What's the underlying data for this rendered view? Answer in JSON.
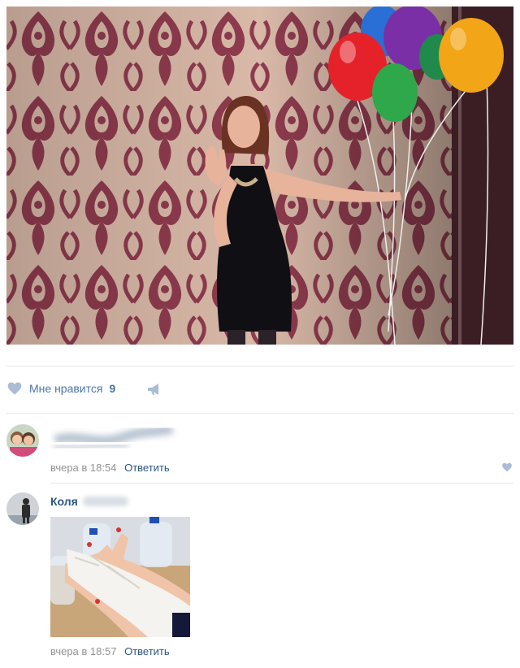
{
  "post": {
    "likes_label": "Мне нравится",
    "likes_count": "9"
  },
  "comments": [
    {
      "author": "",
      "time": "вчера в 18:54",
      "reply_label": "Ответить"
    },
    {
      "author": "Коля",
      "time": "вчера в 18:57",
      "reply_label": "Ответить"
    }
  ],
  "colors": {
    "link": "#2a5885",
    "like_accent": "#4a76a8",
    "meta_text": "#939393",
    "icon_fill": "#aabdd5"
  }
}
